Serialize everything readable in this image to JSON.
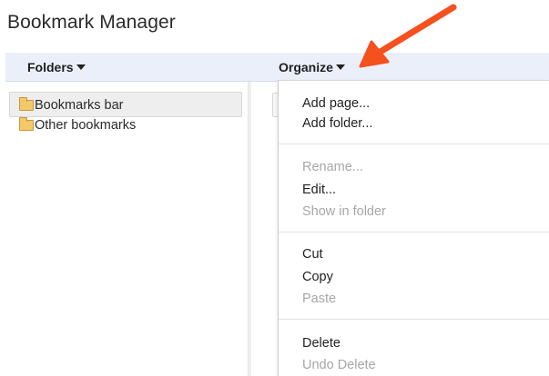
{
  "page": {
    "title": "Bookmark Manager"
  },
  "header": {
    "folders_label": "Folders",
    "organize_label": "Organize"
  },
  "folders": [
    {
      "label": "Bookmarks bar",
      "selected": true
    },
    {
      "label": "Other bookmarks",
      "selected": false
    }
  ],
  "organize_menu": {
    "items": [
      {
        "label": "Add page...",
        "enabled": true
      },
      {
        "label": "Add folder...",
        "enabled": true
      },
      {
        "label": "Rename...",
        "enabled": false
      },
      {
        "label": "Edit...",
        "enabled": true
      },
      {
        "label": "Show in folder",
        "enabled": false
      },
      {
        "label": "Cut",
        "enabled": true
      },
      {
        "label": "Copy",
        "enabled": true
      },
      {
        "label": "Paste",
        "enabled": false
      },
      {
        "label": "Delete",
        "enabled": true
      },
      {
        "label": "Undo Delete",
        "enabled": false
      }
    ]
  },
  "colors": {
    "header_bar": "#ebeff9",
    "annotation_arrow": "#f4511e",
    "folder_icon": "#f4c96b",
    "disabled_text": "#a6a6a6"
  }
}
